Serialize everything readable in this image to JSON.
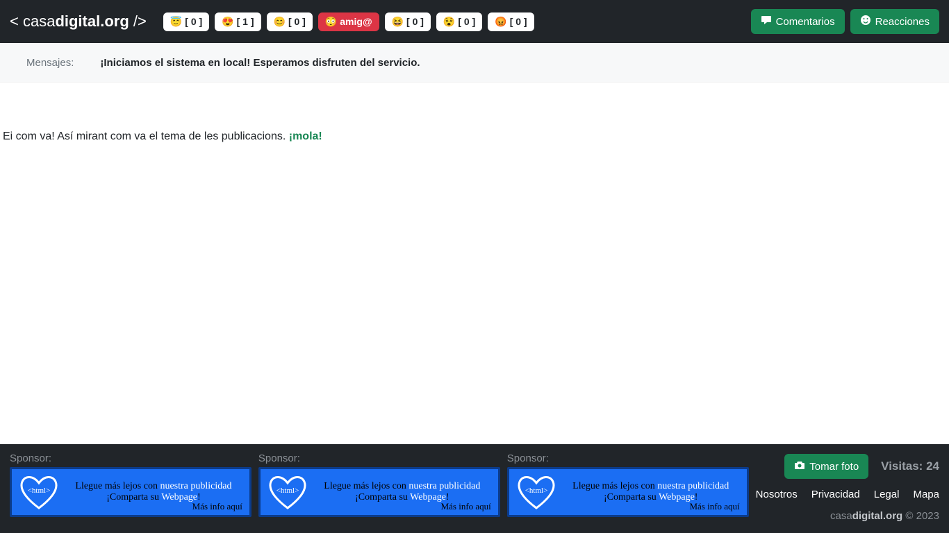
{
  "header": {
    "logo_prefix": "< casa",
    "logo_bold": "digital.org",
    "logo_suffix": " />",
    "reactions": [
      {
        "emoji": "😇",
        "count": "[ 0 ]",
        "label": "",
        "active": false
      },
      {
        "emoji": "😍",
        "count": "[ 1 ]",
        "label": "",
        "active": false
      },
      {
        "emoji": "😊",
        "count": "[ 0 ]",
        "label": "",
        "active": false
      },
      {
        "emoji": "😳",
        "count": "",
        "label": "amig@",
        "active": true
      },
      {
        "emoji": "😆",
        "count": "[ 0 ]",
        "label": "",
        "active": false
      },
      {
        "emoji": "😵",
        "count": "[ 0 ]",
        "label": "",
        "active": false
      },
      {
        "emoji": "😡",
        "count": "[ 0 ]",
        "label": "",
        "active": false
      }
    ],
    "comments_btn": "Comentarios",
    "reactions_btn": "Reacciones"
  },
  "messages": {
    "label": "Mensajes:",
    "text": "¡Iniciamos el sistema en local! Esperamos disfruten del servicio."
  },
  "post": {
    "text": "Ei com va! Así mirant com va el tema de les publicacions. ",
    "highlight": "¡mola!"
  },
  "footer": {
    "sponsor_label": "Sponsor:",
    "banner": {
      "line1_a": "Llegue más lejos con ",
      "line1_b": "nuestra publicidad",
      "line2_a": "¡Comparta su ",
      "line2_b": "Webpage",
      "line2_c": "!",
      "more": "Más info aquí",
      "heart_text": "<html>"
    },
    "take_photo": "Tomar foto",
    "visits_label": "Visitas: ",
    "visits_count": "24",
    "links": {
      "nosotros": "Nosotros",
      "privacidad": "Privacidad",
      "legal": "Legal",
      "mapa": "Mapa"
    },
    "copyright_site_a": "casa",
    "copyright_site_b": "digital.org",
    "copyright_rest": " © 2023"
  }
}
